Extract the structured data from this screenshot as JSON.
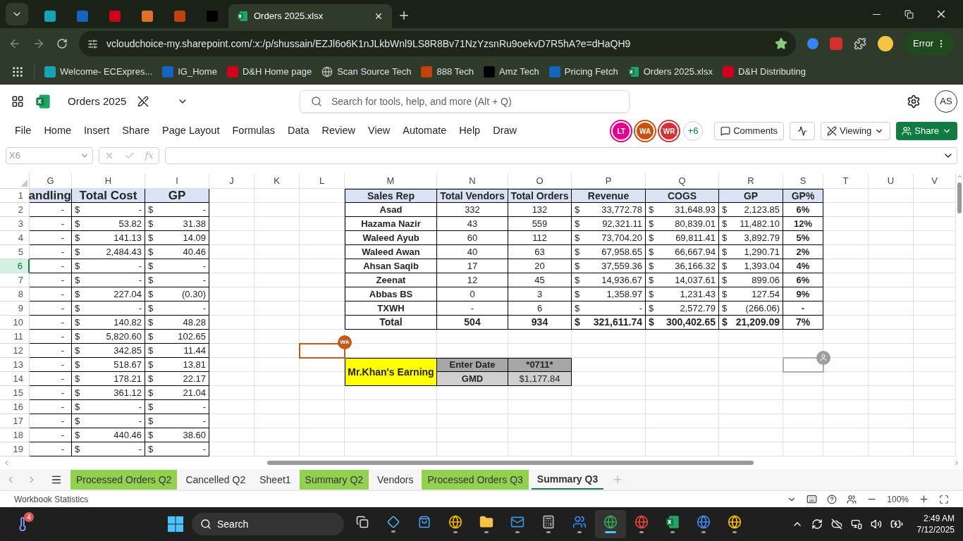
{
  "browser": {
    "tabs": [
      {
        "selected": false
      },
      {
        "selected": false
      },
      {
        "selected": false
      },
      {
        "selected": false
      },
      {
        "selected": false
      },
      {
        "selected": false
      },
      {
        "title": "Orders 2025.xlsx",
        "selected": true
      }
    ],
    "address": "vcloudchoice-my.sharepoint.com/:x:/p/shussain/EZJl6o6K1nJLkbWnl9LS8R8Bv71NzYzsnRu9oekvD7R5hA?e=dHaQH9",
    "bookmarked": true,
    "profile_status": "Error",
    "bookmarks": [
      "Welcome- ECExpres...",
      "IG_Home",
      "D&H Home page",
      "Scan Source Tech",
      "888 Tech",
      "Amz Tech",
      "Pricing Fetch",
      "Orders 2025.xlsx",
      "D&H Distributing"
    ]
  },
  "excel": {
    "file_name": "Orders 2025",
    "search": {
      "placeholder": "Search for tools, help, and more (Alt + Q)"
    },
    "user": "AS",
    "menu": [
      "File",
      "Home",
      "Insert",
      "Share",
      "Page Layout",
      "Formulas",
      "Data",
      "Review",
      "View",
      "Automate",
      "Help",
      "Draw"
    ],
    "collaborators": [
      {
        "initials": "LT",
        "color": "#e3008c"
      },
      {
        "initials": "WA",
        "color": "#ca5010"
      },
      {
        "initials": "WR",
        "color": "#d13438"
      }
    ],
    "more_collaborators": "+6",
    "buttons": {
      "comments": "Comments",
      "mode": "Viewing",
      "share": "Share"
    },
    "name_box": "X6",
    "function_label": "fx"
  },
  "sheet": {
    "columns": [
      "G",
      "H",
      "I",
      "J",
      "K",
      "L",
      "M",
      "N",
      "O",
      "P",
      "Q",
      "R",
      "S",
      "T",
      "U",
      "V"
    ],
    "rows": [
      {
        "number": "1",
        "selected": false
      },
      {
        "number": "2",
        "selected": false
      },
      {
        "number": "3",
        "selected": false
      },
      {
        "number": "4",
        "selected": false
      },
      {
        "number": "5",
        "selected": false
      },
      {
        "number": "6",
        "selected": true
      },
      {
        "number": "7",
        "selected": false
      },
      {
        "number": "8",
        "selected": false
      },
      {
        "number": "9",
        "selected": false
      },
      {
        "number": "10",
        "selected": false
      },
      {
        "number": "11",
        "selected": false
      },
      {
        "number": "12",
        "selected": false
      },
      {
        "number": "13",
        "selected": false
      },
      {
        "number": "14",
        "selected": false
      },
      {
        "number": "15",
        "selected": false
      },
      {
        "number": "16",
        "selected": false
      },
      {
        "number": "17",
        "selected": false
      },
      {
        "number": "18",
        "selected": false
      },
      {
        "number": "19",
        "selected": false
      }
    ],
    "cost_table": {
      "header": [
        "andling",
        "Total Cost",
        "GP"
      ],
      "rows": [
        [
          "-",
          [
            "$",
            "-"
          ],
          [
            "$",
            "-"
          ]
        ],
        [
          "-",
          [
            "$",
            "53.82"
          ],
          [
            "$",
            "31.38"
          ]
        ],
        [
          "-",
          [
            "$",
            "141.13"
          ],
          [
            "$",
            "14.09"
          ]
        ],
        [
          "-",
          [
            "$",
            "2,484.43"
          ],
          [
            "$",
            "40.46"
          ]
        ],
        [
          "-",
          [
            "$",
            "-"
          ],
          [
            "$",
            "-"
          ]
        ],
        [
          "-",
          [
            "$",
            "-"
          ],
          [
            "$",
            "-"
          ]
        ],
        [
          "-",
          [
            "$",
            "227.04"
          ],
          [
            "$",
            "(0.30)"
          ]
        ],
        [
          "-",
          [
            "$",
            "-"
          ],
          [
            "$",
            "-"
          ]
        ],
        [
          "-",
          [
            "$",
            "140.82"
          ],
          [
            "$",
            "48.28"
          ]
        ],
        [
          "-",
          [
            "$",
            "5,820.60"
          ],
          [
            "$",
            "102.65"
          ]
        ],
        [
          "-",
          [
            "$",
            "342.85"
          ],
          [
            "$",
            "11.44"
          ]
        ],
        [
          "-",
          [
            "$",
            "518.67"
          ],
          [
            "$",
            "13.81"
          ]
        ],
        [
          "-",
          [
            "$",
            "178.21"
          ],
          [
            "$",
            "22.17"
          ]
        ],
        [
          "-",
          [
            "$",
            "361.12"
          ],
          [
            "$",
            "21.04"
          ]
        ],
        [
          "-",
          [
            "$",
            "-"
          ],
          [
            "$",
            "-"
          ]
        ],
        [
          "-",
          [
            "$",
            "-"
          ],
          [
            "$",
            "-"
          ]
        ],
        [
          "-",
          [
            "$",
            "440.46"
          ],
          [
            "$",
            "38.60"
          ]
        ],
        [
          "-",
          [
            "$",
            "-"
          ],
          [
            "$",
            "-"
          ]
        ]
      ]
    },
    "summary_table": {
      "header": [
        "Sales Rep",
        "Total Vendors",
        "Total Orders",
        "Revenue",
        "COGS",
        "GP",
        "GP%"
      ],
      "rows": [
        {
          "kind": "data",
          "cells": [
            "Asad",
            "332",
            "132",
            [
              "$",
              "33,772.78"
            ],
            [
              "$",
              "31,648.93"
            ],
            [
              "$",
              "2,123.85"
            ],
            "6%"
          ]
        },
        {
          "kind": "data",
          "cells": [
            "Hazama Nazir",
            "43",
            "559",
            [
              "$",
              "92,321.11"
            ],
            [
              "$",
              "80,839.01"
            ],
            [
              "$",
              "11,482.10"
            ],
            "12%"
          ]
        },
        {
          "kind": "data",
          "cells": [
            "Waleed Ayub",
            "60",
            "112",
            [
              "$",
              "73,704.20"
            ],
            [
              "$",
              "69,811.41"
            ],
            [
              "$",
              "3,892.79"
            ],
            "5%"
          ]
        },
        {
          "kind": "data",
          "cells": [
            "Waleed Awan",
            "40",
            "63",
            [
              "$",
              "67,958.65"
            ],
            [
              "$",
              "66,667.94"
            ],
            [
              "$",
              "1,290.71"
            ],
            "2%"
          ]
        },
        {
          "kind": "data",
          "cells": [
            "Ahsan Saqib",
            "17",
            "20",
            [
              "$",
              "37,559.36"
            ],
            [
              "$",
              "36,166.32"
            ],
            [
              "$",
              "1,393.04"
            ],
            "4%"
          ]
        },
        {
          "kind": "data",
          "cells": [
            "Zeenat",
            "12",
            "45",
            [
              "$",
              "14,936.67"
            ],
            [
              "$",
              "14,037.61"
            ],
            [
              "$",
              "899.06"
            ],
            "6%"
          ]
        },
        {
          "kind": "data",
          "cells": [
            "Abbas BS",
            "0",
            "3",
            [
              "$",
              "1,358.97"
            ],
            [
              "$",
              "1,231.43"
            ],
            [
              "$",
              "127.54"
            ],
            "9%"
          ]
        },
        {
          "kind": "data",
          "cells": [
            "TXWH",
            "-",
            "6",
            [
              "$",
              "-"
            ],
            [
              "$",
              "2,572.79"
            ],
            [
              "$",
              "(266.06)"
            ],
            "-"
          ]
        },
        {
          "kind": "total",
          "cells": [
            "Total",
            "504",
            "934",
            [
              "$",
              "321,611.74"
            ],
            [
              "$",
              "300,402.65"
            ],
            [
              "$",
              "21,209.09"
            ],
            "7%"
          ]
        }
      ]
    },
    "earnings": {
      "title": "Mr.Khan's Earning",
      "rows": [
        {
          "label": "Enter Date",
          "value": "*0711*"
        },
        {
          "label": "GMD",
          "value": "$1,177.84"
        }
      ]
    },
    "cursor": {
      "initials": "WA",
      "color": "#c4591a"
    }
  },
  "sheet_tabs": [
    {
      "label": "Processed Orders Q2",
      "color": "#92d050",
      "selected": false
    },
    {
      "label": "Cancelled Q2",
      "selected": false
    },
    {
      "label": "Sheet1",
      "selected": false
    },
    {
      "label": "Summary Q2",
      "color": "#92d050",
      "selected": false
    },
    {
      "label": "Vendors",
      "selected": false
    },
    {
      "label": "Processed Orders Q3",
      "color": "#92d050",
      "selected": false
    },
    {
      "label": "Summary Q3",
      "selected": true
    }
  ],
  "status_bar": {
    "left": "Workbook Statistics",
    "zoom": "100%"
  },
  "taskbar": {
    "weather_badge": "4",
    "search": "Search",
    "apps": [
      {
        "running": false,
        "selected": false
      },
      {
        "running": true,
        "selected": false
      },
      {
        "running": false,
        "selected": false
      },
      {
        "running": true,
        "selected": false
      },
      {
        "running": true,
        "selected": false
      },
      {
        "running": true,
        "selected": false
      },
      {
        "running": true,
        "selected": false
      },
      {
        "running": true,
        "selected": false
      },
      {
        "running": true,
        "selected": true
      },
      {
        "running": true,
        "selected": false
      },
      {
        "running": true,
        "selected": false
      },
      {
        "running": true,
        "selected": false
      },
      {
        "running": true,
        "selected": false
      }
    ],
    "time": "2:49 AM",
    "date": "7/12/2025"
  }
}
